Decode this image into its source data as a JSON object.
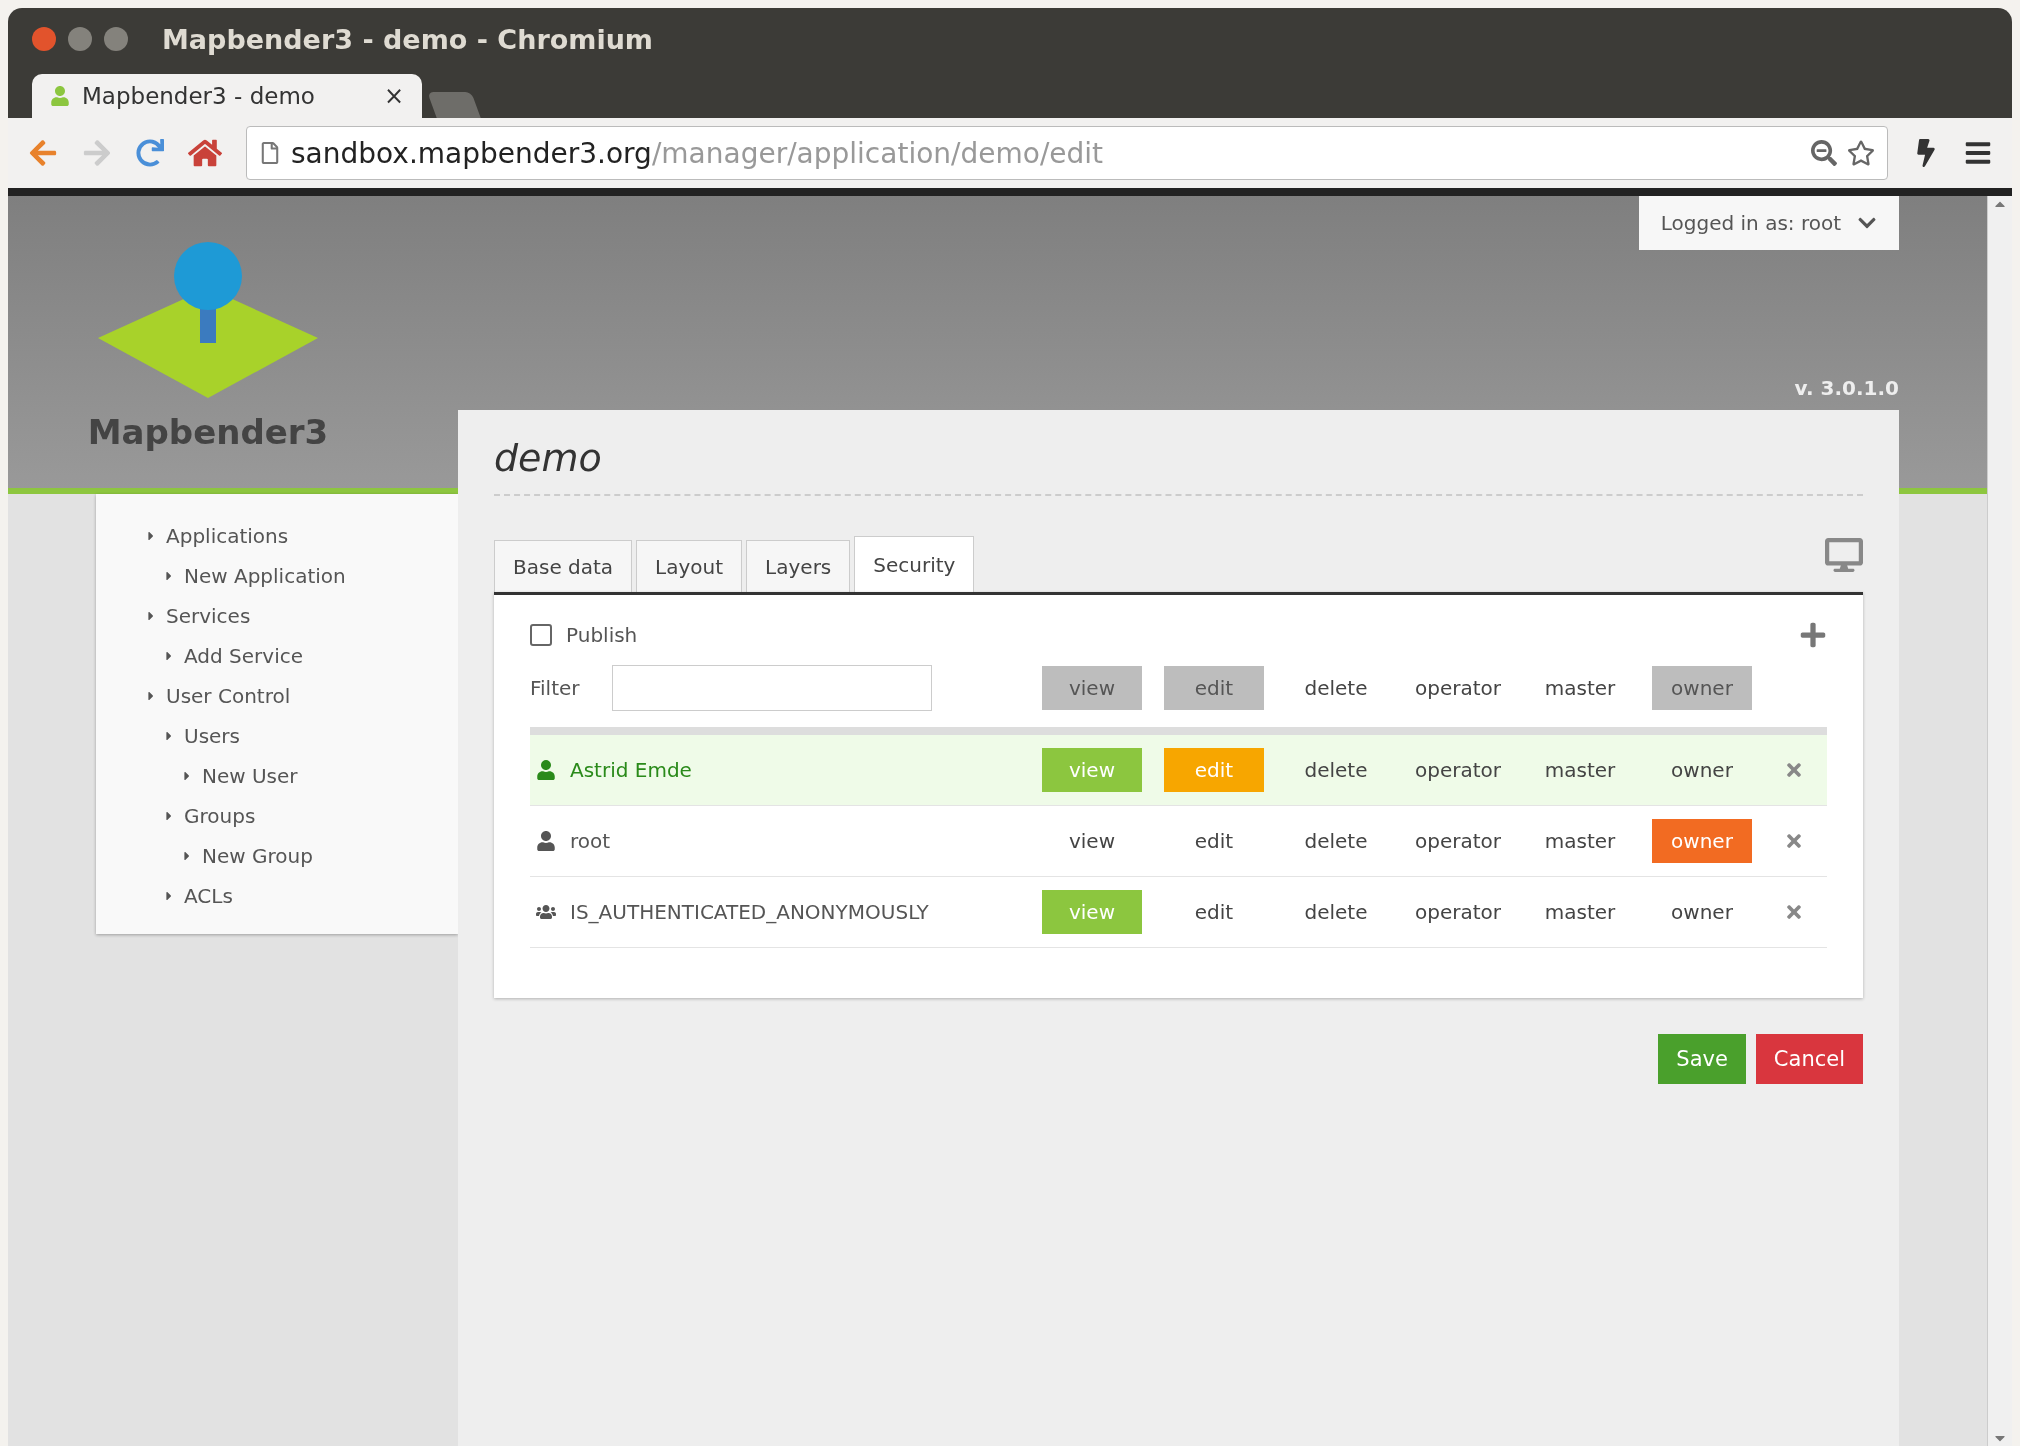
{
  "window": {
    "title": "Mapbender3 - demo - Chromium"
  },
  "browser_tab": {
    "title": "Mapbender3 - demo",
    "close": "×"
  },
  "address_bar": {
    "host": "sandbox.mapbender3.org",
    "path": "/manager/application/demo/edit"
  },
  "account_menu": {
    "label": "Logged in as: root"
  },
  "logo": {
    "name": "Mapbender3"
  },
  "version": "v. 3.0.1.0",
  "sidebar": {
    "items": [
      {
        "label": "Applications",
        "children": [
          {
            "label": "New Application"
          }
        ]
      },
      {
        "label": "Services",
        "children": [
          {
            "label": "Add Service"
          }
        ]
      },
      {
        "label": "User Control",
        "children": [
          {
            "label": "Users",
            "children": [
              {
                "label": "New User"
              }
            ]
          },
          {
            "label": "Groups",
            "children": [
              {
                "label": "New Group"
              }
            ]
          },
          {
            "label": "ACLs"
          }
        ]
      }
    ]
  },
  "application": {
    "title": "demo",
    "tabs": [
      {
        "label": "Base data",
        "selected": false
      },
      {
        "label": "Layout",
        "selected": false
      },
      {
        "label": "Layers",
        "selected": false
      },
      {
        "label": "Security",
        "selected": true
      }
    ],
    "publish": {
      "label": "Publish",
      "checked": false
    },
    "filter": {
      "label": "Filter"
    },
    "permission_header": [
      {
        "label": "view",
        "selected": true,
        "color": "#bdbdbd"
      },
      {
        "label": "edit",
        "selected": true,
        "color": "#bdbdbd"
      },
      {
        "label": "delete",
        "selected": false
      },
      {
        "label": "operator",
        "selected": false
      },
      {
        "label": "master",
        "selected": false
      },
      {
        "label": "owner",
        "selected": true,
        "color": "#bdbdbd"
      }
    ],
    "entries": [
      {
        "name": "Astrid Emde",
        "kind": "user",
        "selected": true,
        "permissions": [
          {
            "label": "view",
            "selected": true,
            "color": "#8cc63f"
          },
          {
            "label": "edit",
            "selected": true,
            "color": "#f7a600"
          },
          {
            "label": "delete",
            "selected": false
          },
          {
            "label": "operator",
            "selected": false
          },
          {
            "label": "master",
            "selected": false
          },
          {
            "label": "owner",
            "selected": false
          }
        ]
      },
      {
        "name": "root",
        "kind": "user",
        "selected": false,
        "permissions": [
          {
            "label": "view",
            "selected": false
          },
          {
            "label": "edit",
            "selected": false
          },
          {
            "label": "delete",
            "selected": false
          },
          {
            "label": "operator",
            "selected": false
          },
          {
            "label": "master",
            "selected": false
          },
          {
            "label": "owner",
            "selected": true,
            "color": "#f26b22"
          }
        ]
      },
      {
        "name": "IS_AUTHENTICATED_ANONYMOUSLY",
        "kind": "group",
        "selected": false,
        "permissions": [
          {
            "label": "view",
            "selected": true,
            "color": "#8cc63f"
          },
          {
            "label": "edit",
            "selected": false
          },
          {
            "label": "delete",
            "selected": false
          },
          {
            "label": "operator",
            "selected": false
          },
          {
            "label": "master",
            "selected": false
          },
          {
            "label": "owner",
            "selected": false
          }
        ]
      }
    ]
  },
  "buttons": [
    {
      "label": "Save",
      "kind": "primary"
    },
    {
      "label": "Cancel",
      "kind": "danger"
    }
  ]
}
